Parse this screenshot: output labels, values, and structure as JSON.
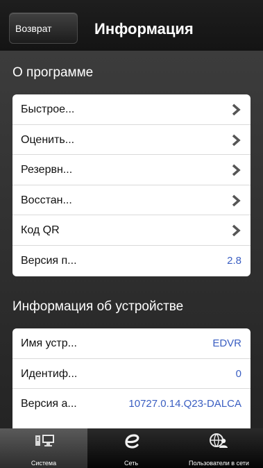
{
  "header": {
    "back_label": "Возврат",
    "title": "Информация"
  },
  "about": {
    "section_title": "О программе",
    "items": [
      {
        "label": "Быстрое...",
        "icon": "chevron-right-icon"
      },
      {
        "label": "Оценить...",
        "icon": "chevron-right-icon"
      },
      {
        "label": "Резервн...",
        "icon": "chevron-right-icon"
      },
      {
        "label": "Восстан...",
        "icon": "chevron-right-icon"
      },
      {
        "label": "Код QR",
        "icon": "chevron-right-icon"
      },
      {
        "label": "Версия п...",
        "value": "2.8"
      }
    ]
  },
  "device": {
    "section_title": "Информация об устройстве",
    "items": [
      {
        "label": "Имя устр...",
        "value": "EDVR"
      },
      {
        "label": "Идентиф...",
        "value": "0"
      },
      {
        "label": "Версия а...",
        "value": "10727.0.14.Q23-DALCA"
      }
    ]
  },
  "tabs": [
    {
      "label": "Система",
      "icon": "monitor-icon",
      "active": true
    },
    {
      "label": "Сеть",
      "icon": "network-e-icon",
      "active": false
    },
    {
      "label": "Пользователи в сети",
      "icon": "globe-users-icon",
      "active": false
    }
  ],
  "colors": {
    "accent_value": "#3a5ec2",
    "header_bg": "#141414",
    "content_bg": "#333333"
  }
}
